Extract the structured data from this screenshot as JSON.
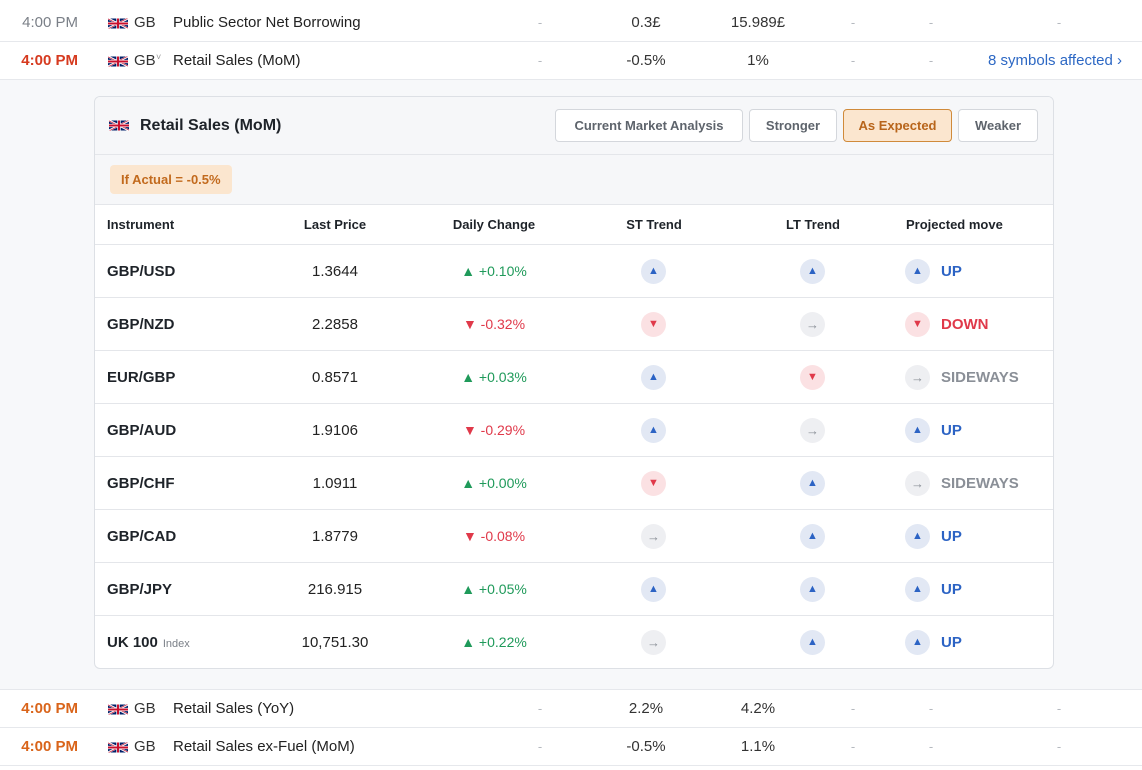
{
  "calendar_rows_top": [
    {
      "time": "4:00 PM",
      "country": "GB",
      "event": "Public Sector Net Borrowing",
      "col1": "-",
      "actual": "0.3£",
      "forecast": "15.989£",
      "col4": "-",
      "col5": "-",
      "col6": "-"
    },
    {
      "time": "4:00 PM",
      "country": "GB",
      "event": "Retail Sales (MoM)",
      "col1": "-",
      "actual": "-0.5%",
      "forecast": "1%",
      "col4": "-",
      "col5": "-",
      "affected": "8 symbols affected ›",
      "caret": "˅"
    }
  ],
  "panel": {
    "title": "Retail Sales (MoM)",
    "tabs": [
      "Current Market Analysis",
      "Stronger",
      "As Expected",
      "Weaker"
    ],
    "active_tab": "As Expected",
    "if_actual": "If Actual = -0.5%",
    "headers": {
      "instrument": "Instrument",
      "last_price": "Last Price",
      "daily_change": "Daily Change",
      "st_trend": "ST Trend",
      "lt_trend": "LT Trend",
      "projected": "Projected move"
    },
    "rows": [
      {
        "instrument": "GBP/USD",
        "tag": "",
        "price": "1.3644",
        "change": "▲ +0.10%",
        "change_dir": "up",
        "st": "up",
        "lt": "up",
        "proj_dir": "up",
        "proj": "UP"
      },
      {
        "instrument": "GBP/NZD",
        "tag": "",
        "price": "2.2858",
        "change": "▼ -0.32%",
        "change_dir": "down",
        "st": "down",
        "lt": "side",
        "proj_dir": "down",
        "proj": "DOWN"
      },
      {
        "instrument": "EUR/GBP",
        "tag": "",
        "price": "0.8571",
        "change": "▲ +0.03%",
        "change_dir": "up",
        "st": "up",
        "lt": "down",
        "proj_dir": "side",
        "proj": "SIDEWAYS"
      },
      {
        "instrument": "GBP/AUD",
        "tag": "",
        "price": "1.9106",
        "change": "▼ -0.29%",
        "change_dir": "down",
        "st": "up",
        "lt": "side",
        "proj_dir": "up",
        "proj": "UP"
      },
      {
        "instrument": "GBP/CHF",
        "tag": "",
        "price": "1.0911",
        "change": "▲ +0.00%",
        "change_dir": "up",
        "st": "down",
        "lt": "up",
        "proj_dir": "side",
        "proj": "SIDEWAYS"
      },
      {
        "instrument": "GBP/CAD",
        "tag": "",
        "price": "1.8779",
        "change": "▼ -0.08%",
        "change_dir": "down",
        "st": "side",
        "lt": "up",
        "proj_dir": "up",
        "proj": "UP"
      },
      {
        "instrument": "GBP/JPY",
        "tag": "",
        "price": "216.915",
        "change": "▲ +0.05%",
        "change_dir": "up",
        "st": "up",
        "lt": "up",
        "proj_dir": "up",
        "proj": "UP"
      },
      {
        "instrument": "UK 100",
        "tag": "Index",
        "price": "10,751.30",
        "change": "▲ +0.22%",
        "change_dir": "up",
        "st": "side",
        "lt": "up",
        "proj_dir": "up",
        "proj": "UP"
      }
    ]
  },
  "calendar_rows_bottom": [
    {
      "time": "4:00 PM",
      "country": "GB",
      "event": "Retail Sales (YoY)",
      "col1": "-",
      "actual": "2.2%",
      "forecast": "4.2%",
      "col4": "-",
      "col5": "-",
      "col6": "-"
    },
    {
      "time": "4:00 PM",
      "country": "GB",
      "event": "Retail Sales ex-Fuel (MoM)",
      "col1": "-",
      "actual": "-0.5%",
      "forecast": "1.1%",
      "col4": "-",
      "col5": "-",
      "col6": "-"
    }
  ],
  "icons": {
    "up": "▲",
    "down": "▼",
    "side": "→"
  },
  "colors": {
    "up": "#2c63c4",
    "down": "#e0394a",
    "positive": "#1f9a5a",
    "accent": "#d08a3a"
  }
}
